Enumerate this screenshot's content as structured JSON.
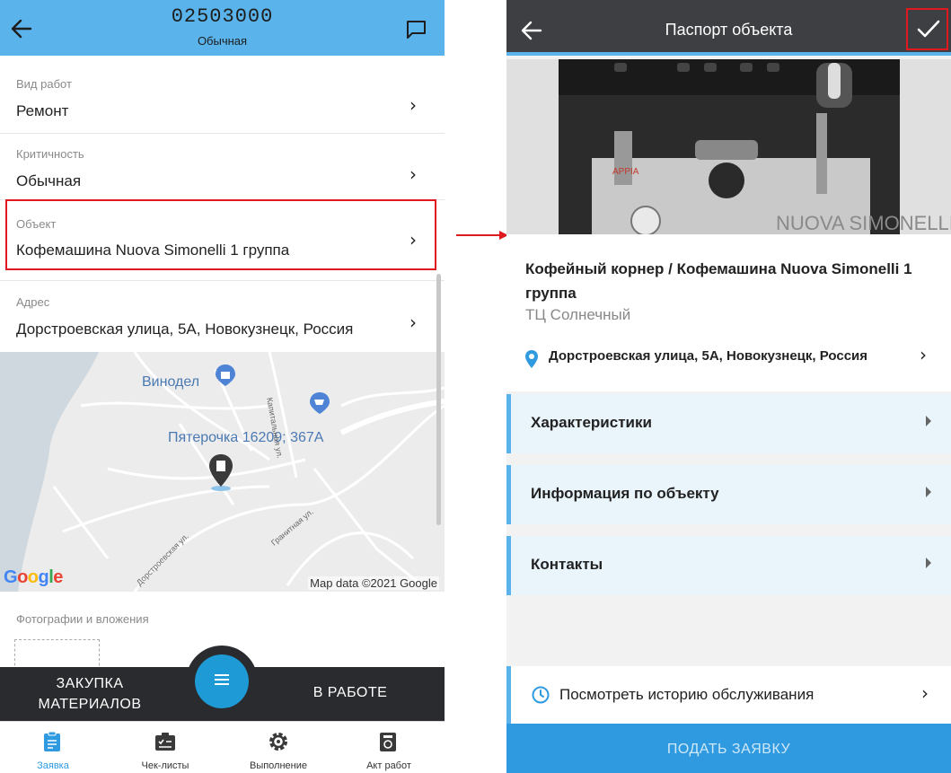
{
  "left": {
    "header": {
      "title": "02503000",
      "subtitle": "Обычная"
    },
    "fields": [
      {
        "label": "Вид работ",
        "value": "Ремонт"
      },
      {
        "label": "Критичность",
        "value": "Обычная"
      },
      {
        "label": "Объект",
        "value": "Кофемашина Nuova Simonelli 1 группа"
      },
      {
        "label": "Адрес",
        "value": "Дорстроевская улица, 5А, Новокузнецк, Россия"
      }
    ],
    "map": {
      "places": [
        "Винодел",
        "Пятерочка 16209; 367А"
      ],
      "streets": [
        "Капитальная ул.",
        "Дорстроевская ул.",
        "Гранитная ул."
      ],
      "credit": "Map data ©2021 Google",
      "logo": "Google"
    },
    "photos_label": "Фотографии и вложения",
    "action_bar": {
      "left_label_1": "ЗАКУПКА",
      "left_label_2": "МАТЕРИАЛОВ",
      "right_label": "В РАБОТЕ"
    },
    "bottom_nav": [
      {
        "label": "Заявка",
        "icon": "clipboard-icon",
        "active": true
      },
      {
        "label": "Чек-листы",
        "icon": "checklist-icon",
        "active": false
      },
      {
        "label": "Выполнение",
        "icon": "gear-icon",
        "active": false
      },
      {
        "label": "Акт работ",
        "icon": "report-icon",
        "active": false
      }
    ]
  },
  "right": {
    "header": {
      "title": "Паспорт объекта"
    },
    "object_title": "Кофейный корнер / Кофемашина Nuova Simonelli 1 группа",
    "object_subtitle": "ТЦ Солнечный",
    "address": "Дорстроевская улица, 5А, Новокузнецк, Россия",
    "photo_brand": "NUOVA SIMONELLI",
    "photo_brand_left": "APPIA",
    "sections": [
      "Характеристики",
      "Информация по объекту",
      "Контакты"
    ],
    "history_label": "Посмотреть историю обслуживания",
    "submit_label": "ПОДАТЬ ЗАЯВКУ"
  },
  "colors": {
    "accent_blue": "#5ab3ea",
    "fab_blue": "#1e9ad6",
    "dark_bar": "#2a2b2e",
    "header_dark": "#3e3f42",
    "highlight_red": "#e0191f",
    "section_bg": "#e9f4fb"
  }
}
